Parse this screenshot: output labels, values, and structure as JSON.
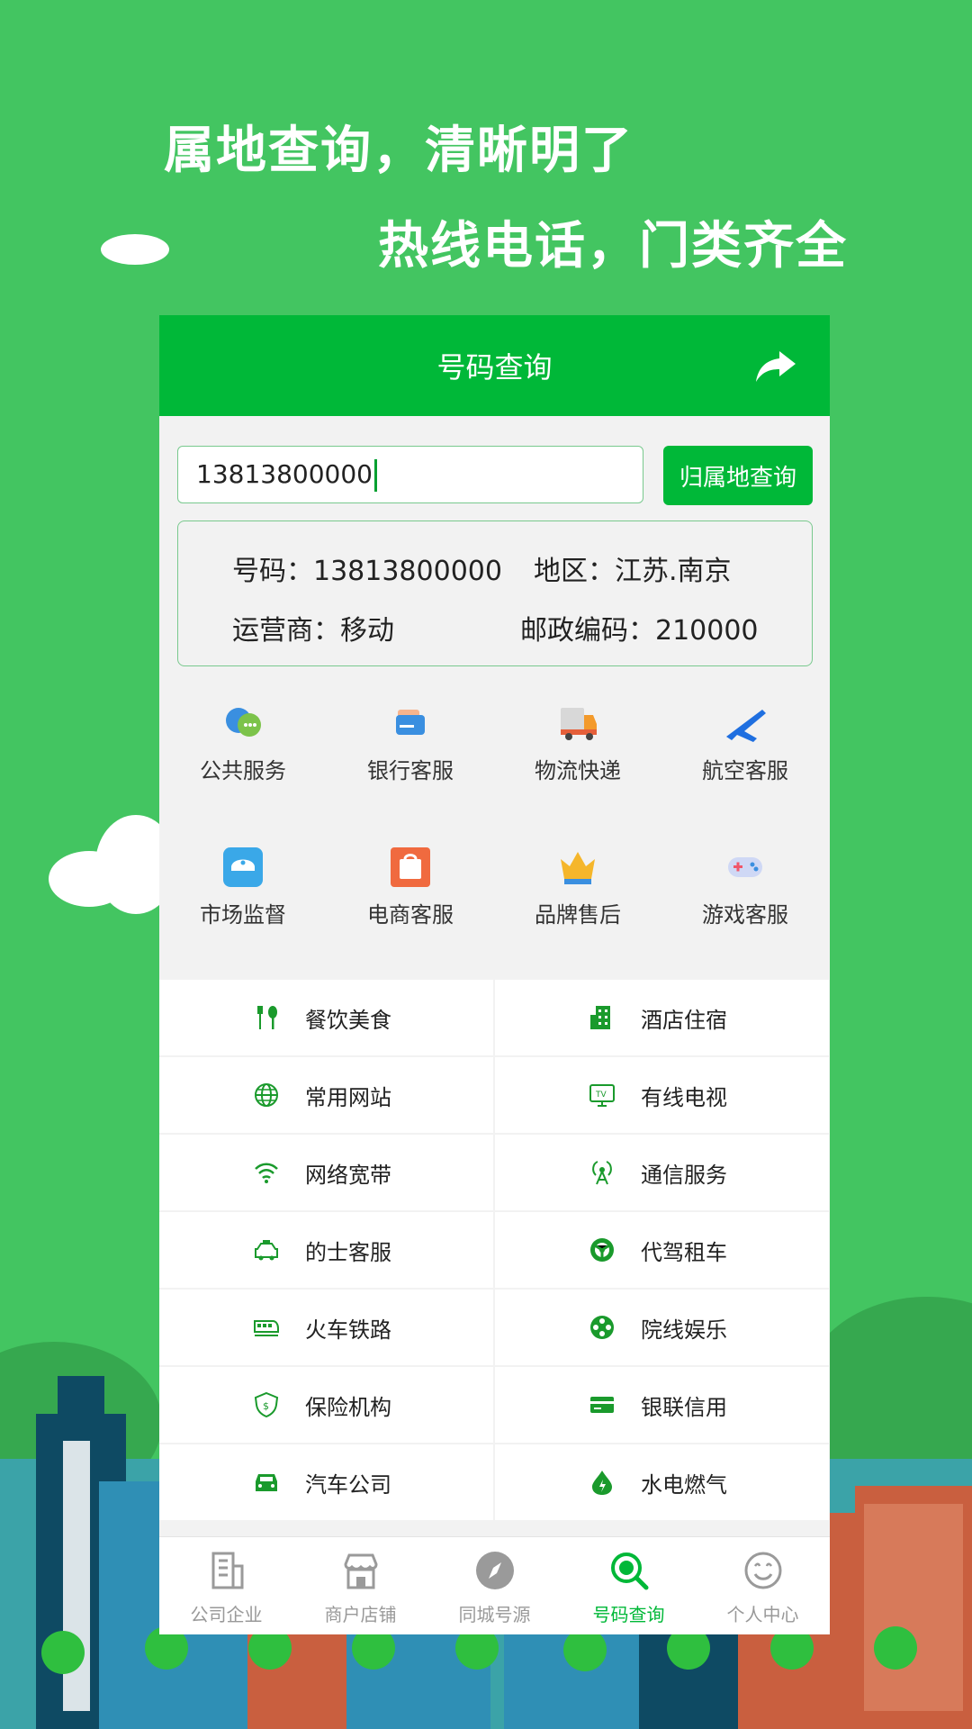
{
  "promo": {
    "line1": "属地查询，清晰明了",
    "line2": "热线电话，门类齐全"
  },
  "app": {
    "title": "号码查询",
    "share_icon": "share-icon"
  },
  "search": {
    "value": "13813800000",
    "button_label": "归属地查询"
  },
  "result": {
    "number_label": "号码：",
    "number_value": "13813800000",
    "region_label": "地区：",
    "region_value": "江苏.南京",
    "carrier_label": "运营商：",
    "carrier_value": "移动",
    "postcode_label": "邮政编码：",
    "postcode_value": "210000"
  },
  "categories": [
    {
      "label": "公共服务",
      "icon": "chat-bubbles-icon"
    },
    {
      "label": "银行客服",
      "icon": "bank-card-icon"
    },
    {
      "label": "物流快递",
      "icon": "truck-icon"
    },
    {
      "label": "航空客服",
      "icon": "airplane-icon"
    },
    {
      "label": "市场监督",
      "icon": "police-cap-icon"
    },
    {
      "label": "电商客服",
      "icon": "shopping-bag-icon"
    },
    {
      "label": "品牌售后",
      "icon": "crown-icon"
    },
    {
      "label": "游戏客服",
      "icon": "gamepad-icon"
    }
  ],
  "services": [
    {
      "label": "餐饮美食",
      "icon": "fork-spoon-icon"
    },
    {
      "label": "酒店住宿",
      "icon": "building-icon"
    },
    {
      "label": "常用网站",
      "icon": "globe-icon"
    },
    {
      "label": "有线电视",
      "icon": "tv-icon"
    },
    {
      "label": "网络宽带",
      "icon": "wifi-icon"
    },
    {
      "label": "通信服务",
      "icon": "antenna-icon"
    },
    {
      "label": "的士客服",
      "icon": "taxi-icon"
    },
    {
      "label": "代驾租车",
      "icon": "steering-wheel-icon"
    },
    {
      "label": "火车铁路",
      "icon": "train-icon"
    },
    {
      "label": "院线娱乐",
      "icon": "film-reel-icon"
    },
    {
      "label": "保险机构",
      "icon": "shield-icon"
    },
    {
      "label": "银联信用",
      "icon": "credit-card-icon"
    },
    {
      "label": "汽车公司",
      "icon": "car-icon"
    },
    {
      "label": "水电燃气",
      "icon": "water-drop-icon"
    }
  ],
  "tabs": [
    {
      "label": "公司企业",
      "icon": "office-building-icon"
    },
    {
      "label": "商户店铺",
      "icon": "store-icon"
    },
    {
      "label": "同城号源",
      "icon": "compass-icon"
    },
    {
      "label": "号码查询",
      "icon": "search-magnifier-icon",
      "active": true
    },
    {
      "label": "个人中心",
      "icon": "smiley-icon"
    }
  ],
  "colors": {
    "background": "#43c561",
    "accent": "#00b838",
    "service_icon": "#1a9a2c"
  }
}
